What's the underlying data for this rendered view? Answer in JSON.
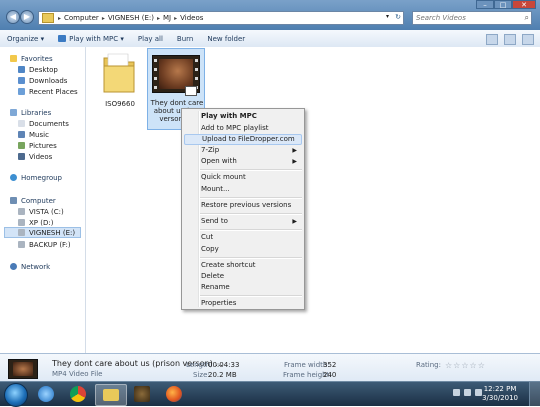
{
  "address_bar": {
    "breadcrumbs": [
      "Computer",
      "VIGNESH (E:)",
      "MJ",
      "Videos"
    ],
    "search_placeholder": "Search Videos"
  },
  "toolbar": {
    "organize": "Organize ▾",
    "play_with": "Play with MPC ▾",
    "play_all": "Play all",
    "burn": "Burn",
    "new_folder": "New folder"
  },
  "navigation": {
    "favorites": {
      "label": "Favorites",
      "items": [
        "Desktop",
        "Downloads",
        "Recent Places"
      ]
    },
    "libraries": {
      "label": "Libraries",
      "items": [
        "Documents",
        "Music",
        "Pictures",
        "Videos"
      ]
    },
    "homegroup": "Homegroup",
    "computer": {
      "label": "Computer",
      "items": [
        "VISTA (C:)",
        "XP (D:)",
        "VIGNESH (E:)",
        "BACKUP (F:)"
      ],
      "selected": "VIGNESH (E:)"
    },
    "network": "Network"
  },
  "files": {
    "folder": {
      "name": "ISO9660",
      "icon": "folder-icon"
    },
    "video": {
      "name": "They dont care about us (p... verson) ...",
      "icon": "video-file-icon"
    }
  },
  "context_menu": {
    "default_item": "Play with MPC",
    "items": [
      "Play with MPC",
      "Add to MPC playlist",
      "Upload to FileDropper.com",
      "7-Zip",
      "Open with",
      "Quick mount",
      "Mount...",
      "Restore previous versions",
      "Send to",
      "Cut",
      "Copy",
      "Create shortcut",
      "Delete",
      "Rename",
      "Properties"
    ],
    "highlighted": "Upload to FileDropper.com",
    "submenu_items": [
      "7-Zip",
      "Open with",
      "Send to"
    ]
  },
  "details": {
    "title": "They dont care about us (prison verson) ...",
    "type": "MP4 Video File",
    "length_label": "Length:",
    "length": "00:04:33",
    "size_label": "Size:",
    "size": "20.2 MB",
    "frame_width_label": "Frame width:",
    "frame_width": "352",
    "frame_height_label": "Frame height:",
    "frame_height": "240",
    "rating_label": "Rating:",
    "rating_stars": "☆☆☆☆☆"
  },
  "taskbar": {
    "time": "12:22 PM",
    "date": "3/30/2010",
    "apps": [
      "internet-explorer-icon",
      "chrome-icon",
      "explorer-icon",
      "media-player-icon",
      "firefox-icon"
    ]
  },
  "colors": {
    "accent": "#3c7bc3",
    "selection": "#cde3f8",
    "taskbar": "#1b2f44"
  }
}
